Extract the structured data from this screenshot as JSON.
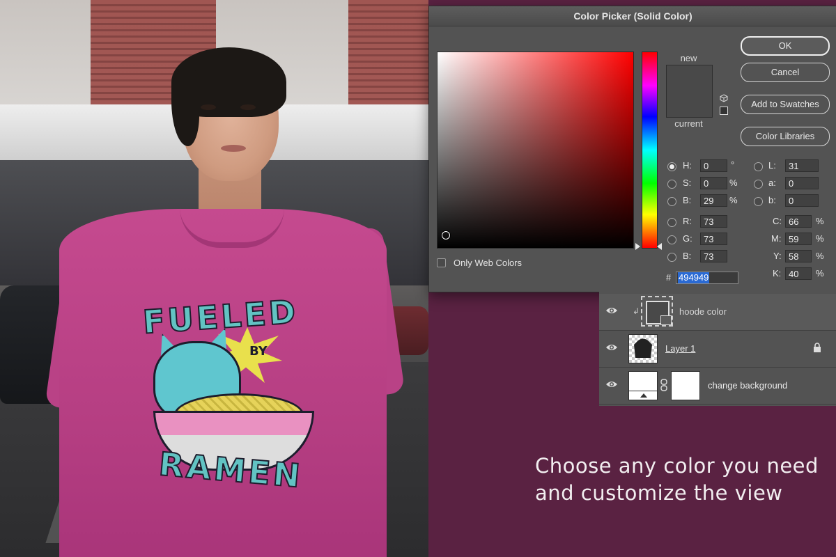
{
  "photo": {
    "shirt_print": {
      "line1": "FUELED",
      "line2": "BY",
      "line3": "RAMEN"
    }
  },
  "dialog": {
    "title": "Color Picker (Solid Color)",
    "buttons": {
      "ok": "OK",
      "cancel": "Cancel",
      "add_to_swatches": "Add to Swatches",
      "color_libraries": "Color Libraries"
    },
    "swatch_labels": {
      "new": "new",
      "current": "current"
    },
    "swatch_color": "#494949",
    "only_web_colors": "Only Web Colors",
    "hsb": {
      "h": {
        "label": "H:",
        "value": "0",
        "unit": "°"
      },
      "s": {
        "label": "S:",
        "value": "0",
        "unit": "%"
      },
      "b": {
        "label": "B:",
        "value": "29",
        "unit": "%"
      }
    },
    "rgb": {
      "r": {
        "label": "R:",
        "value": "73"
      },
      "g": {
        "label": "G:",
        "value": "73"
      },
      "b": {
        "label": "B:",
        "value": "73"
      }
    },
    "lab": {
      "l": {
        "label": "L:",
        "value": "31"
      },
      "a": {
        "label": "a:",
        "value": "0"
      },
      "b": {
        "label": "b:",
        "value": "0"
      }
    },
    "cmyk": {
      "c": {
        "label": "C:",
        "value": "66",
        "unit": "%"
      },
      "m": {
        "label": "M:",
        "value": "59",
        "unit": "%"
      },
      "y": {
        "label": "Y:",
        "value": "58",
        "unit": "%"
      },
      "k": {
        "label": "K:",
        "value": "40",
        "unit": "%"
      }
    },
    "hex": {
      "label": "#",
      "value": "494949"
    }
  },
  "layers": [
    {
      "name": "hoode color",
      "icon": "eye-icon"
    },
    {
      "name": "Layer 1",
      "icon": "eye-icon",
      "locked": true
    },
    {
      "name": "change background",
      "icon": "eye-icon"
    }
  ],
  "caption": {
    "line1": "Choose any color you need",
    "line2": "and customize the view"
  },
  "colors": {
    "background": "#5a2242",
    "dialog": "#535353",
    "hex_highlight": "#2a6ad4"
  }
}
